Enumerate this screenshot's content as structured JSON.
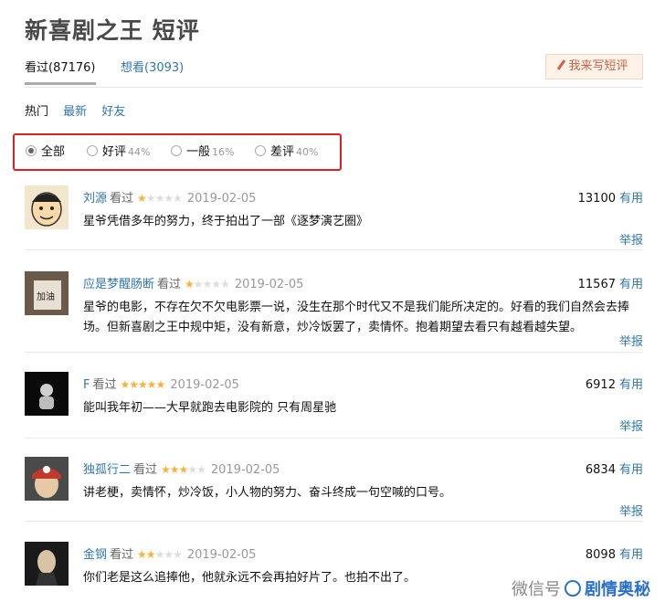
{
  "page": {
    "title": "新喜剧之王 短评"
  },
  "tabs": [
    {
      "label": "看过(87176)"
    },
    {
      "label": "想看(3093)"
    }
  ],
  "write_button": {
    "label": "我来写短评"
  },
  "sort": [
    "热门",
    "最新",
    "好友"
  ],
  "filters": [
    {
      "label": "全部",
      "pct": "",
      "checked": true
    },
    {
      "label": "好评",
      "pct": "44%",
      "checked": false
    },
    {
      "label": "一般",
      "pct": "16%",
      "checked": false
    },
    {
      "label": "差评",
      "pct": "40%",
      "checked": false
    }
  ],
  "useful_label": "有用",
  "report_label": "举报",
  "comments": [
    {
      "user": "刘源",
      "watched": "看过",
      "rating": 1,
      "date": "2019-02-05",
      "votes": "13100",
      "text": "星爷凭借多年的努力，终于拍出了一部《逐梦演艺圈》"
    },
    {
      "user": "应是梦醒肠断",
      "watched": "看过",
      "rating": 1,
      "date": "2019-02-05",
      "votes": "11567",
      "text": "星爷的电影，不存在欠不欠电影票一说，没生在那个时代又不是我们能所决定的。好看的我们自然会去捧场。但新喜剧之王中规中矩，没有新意，炒冷饭罢了，卖情怀。抱着期望去看只有越看越失望。"
    },
    {
      "user": "F",
      "watched": "看过",
      "rating": 5,
      "date": "2019-02-05",
      "votes": "6912",
      "text": "能叫我年初——大早就跑去电影院的 只有周星驰"
    },
    {
      "user": "独孤行二",
      "watched": "看过",
      "rating": 3,
      "date": "2019-02-05",
      "votes": "6834",
      "text": "讲老梗，卖情怀，炒冷饭，小人物的努力、奋斗终成一句空喊的口号。"
    },
    {
      "user": "金钢",
      "watched": "看过",
      "rating": 2,
      "date": "2019-02-05",
      "votes": "8098",
      "text": "你们老是这么追捧他，他就永远不会再拍好片了。也拍不出了。"
    }
  ],
  "watermark": {
    "prefix": "微信号",
    "brand": "剧情奥秘"
  },
  "colors": {
    "link": "#3377aa",
    "star": "#f6b23a",
    "highlight": "#e02020"
  }
}
